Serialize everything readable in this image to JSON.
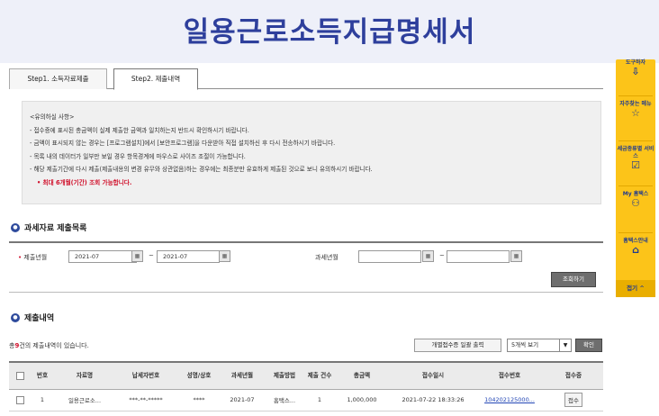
{
  "page_title": "일용근로소득지급명세서",
  "tabs": [
    "Step1. 소득자료제출",
    "Step2. 제출내역"
  ],
  "notice": {
    "heading": "<유의하실 사항>",
    "lines": [
      "- 접수증에 표시된 총금액이 실제 제출한 금액과 일치하는지 반드시 확인하시기 바랍니다.",
      "- 금액이 표시되지 않는 경우는 [프로그램설치]에서 [보안프로그램]을 다운받아 직접 설치하신 후 다시 전송하시기 바랍니다.",
      "- 목록 내의 데이터가 일부만 보일 경우 항목경계에 마우스로 사이즈 조절이 가능합니다.",
      "- 해당 제출기간에 다시 제출(제출내용의 변경 유무와 상관없음)하는 경우에는 최종분만 유효하게 제출된 것으로 보니 유의하시기 바랍니다."
    ],
    "warning": "• 최대 6개월(기간) 조회 가능합니다."
  },
  "search_section": {
    "title": "과세자료 제출목록",
    "submit_label": "제출년월",
    "submit_from": "2021-07",
    "submit_to": "2021-07",
    "tilde": "~",
    "tax_label": "과세년월",
    "tax_from": "",
    "tax_to": "",
    "search_button": "조회하기"
  },
  "history_section": {
    "title": "제출내역",
    "count_prefix": "총",
    "count": "9",
    "count_suffix": "건의 제출내역이 있습니다.",
    "bulk_print_button": "개별접수증 일괄 출력",
    "page_size_select": "5개씩 보기",
    "confirm_button": "확인"
  },
  "table": {
    "headers": [
      "",
      "번호",
      "자료명",
      "납세자번호",
      "성명/상호",
      "과세년월",
      "제출방법",
      "제출 건수",
      "총금액",
      "접수일시",
      "접수번호",
      "접수증"
    ],
    "rows": [
      [
        "",
        "1",
        "일용근로소...",
        "***-**-*****",
        "****",
        "2021-07",
        "홈택스...",
        "1",
        "1,000,000",
        "2021-07-22 18:33:26",
        "104202125000...",
        "접수"
      ]
    ]
  },
  "sidebar": {
    "top_partial": "도구하자",
    "items": [
      "자주찾는 메뉴",
      "세금종류별 서비스",
      "My 홈택스",
      "홈택스안내"
    ],
    "close_label": "접기"
  },
  "colors": {
    "title": "#2e3f9c",
    "sidebar": "#fcc419",
    "warning": "#d0102b",
    "link": "#2246b5"
  }
}
